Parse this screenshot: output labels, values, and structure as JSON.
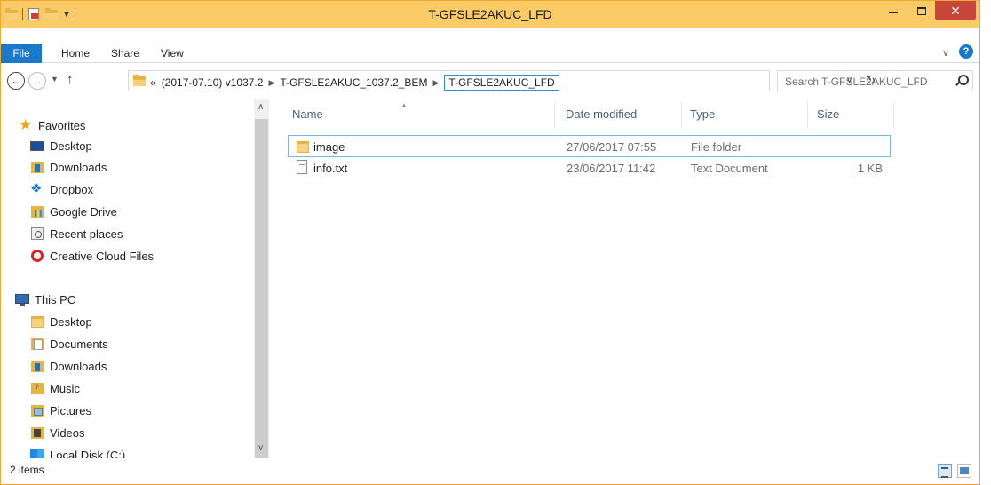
{
  "window": {
    "title": "T-GFSLE2AKUC_LFD",
    "close_glyph": "✕",
    "accent": "#fbcb68",
    "close_color": "#c7453b"
  },
  "ribbon": {
    "tabs": [
      {
        "label": "File"
      },
      {
        "label": "Home"
      },
      {
        "label": "Share"
      },
      {
        "label": "View"
      }
    ],
    "help_glyph": "?"
  },
  "address": {
    "more_glyph": "«",
    "crumbs": [
      "(2017-07.10) v1037.2",
      "T-GFSLE2AKUC_1037.2_BEM",
      "T-GFSLE2AKUC_LFD"
    ],
    "search_placeholder": "Search T-GFSLE2AKUC_LFD"
  },
  "nav": {
    "favorites": {
      "label": "Favorites",
      "items": [
        {
          "label": "Desktop",
          "icon": "desktop-icon"
        },
        {
          "label": "Downloads",
          "icon": "downloads-folder-icon"
        },
        {
          "label": "Dropbox",
          "icon": "dropbox-icon"
        },
        {
          "label": "Google Drive",
          "icon": "google-drive-folder-icon"
        },
        {
          "label": "Recent places",
          "icon": "recent-places-icon"
        },
        {
          "label": "Creative Cloud Files",
          "icon": "creative-cloud-icon"
        }
      ]
    },
    "this_pc": {
      "label": "This PC",
      "items": [
        {
          "label": "Desktop",
          "icon": "desktop-folder-icon"
        },
        {
          "label": "Documents",
          "icon": "documents-folder-icon"
        },
        {
          "label": "Downloads",
          "icon": "downloads-folder-icon"
        },
        {
          "label": "Music",
          "icon": "music-folder-icon"
        },
        {
          "label": "Pictures",
          "icon": "pictures-folder-icon"
        },
        {
          "label": "Videos",
          "icon": "videos-folder-icon"
        },
        {
          "label": "Local Disk (C:)",
          "icon": "local-disk-icon"
        }
      ]
    }
  },
  "files": {
    "columns": {
      "name": "Name",
      "date": "Date modified",
      "type": "Type",
      "size": "Size"
    },
    "rows": [
      {
        "name": "image",
        "date": "27/06/2017 07:55",
        "type": "File folder",
        "size": "",
        "icon": "folder-icon"
      },
      {
        "name": "info.txt",
        "date": "23/06/2017 11:42",
        "type": "Text Document",
        "size": "1 KB",
        "icon": "text-file-icon"
      }
    ]
  },
  "status": {
    "items_count": "2 items"
  }
}
